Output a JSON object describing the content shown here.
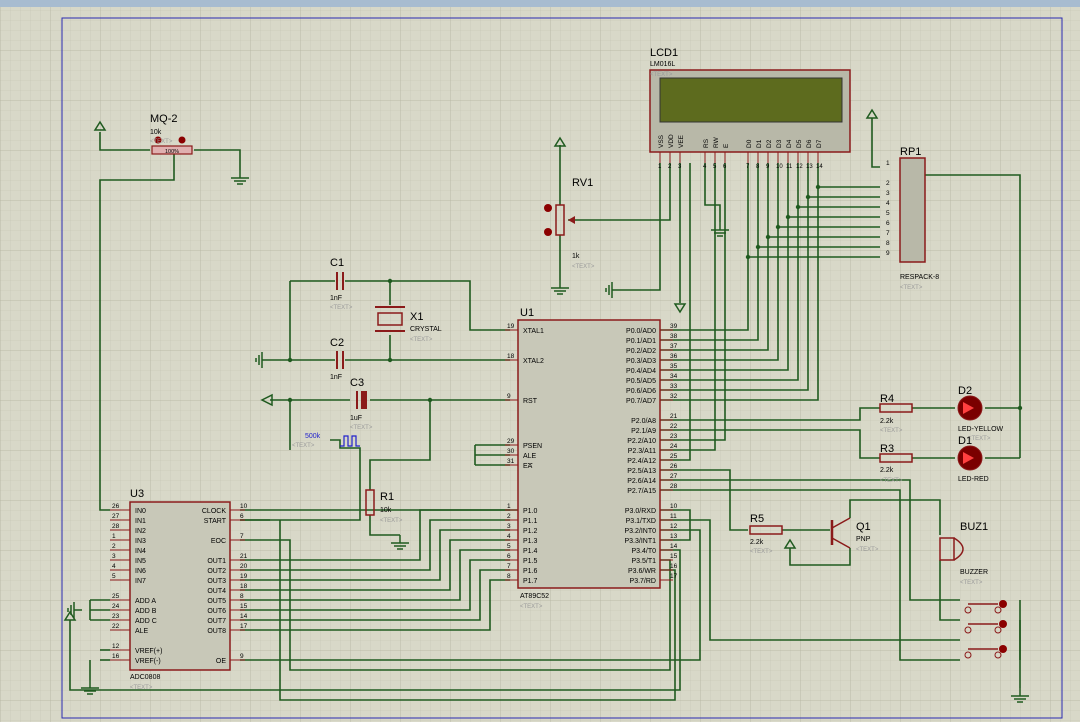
{
  "colors": {
    "wire": "#1f5a1f",
    "part": "#8b1a1a",
    "text": "#000000",
    "ref": "#000000",
    "placeholder": "#9a9a9a",
    "lcd_screen": "#5d6b1e",
    "border": "#2a2ab0",
    "dot": "#8b0000"
  },
  "components": {
    "lcd": {
      "ref": "LCD1",
      "model": "LM016L",
      "text_tag": "<TEXT>",
      "pins": [
        "VSS",
        "VDD",
        "VEE",
        "RS",
        "RW",
        "E",
        "D0",
        "D1",
        "D2",
        "D3",
        "D4",
        "D5",
        "D6",
        "D7"
      ],
      "pin_nums": [
        "1",
        "2",
        "3",
        "4",
        "5",
        "6",
        "7",
        "8",
        "9",
        "10",
        "11",
        "12",
        "13",
        "14"
      ]
    },
    "mq2": {
      "ref": "MQ-2",
      "value": "10k",
      "text_tag": "<TEXT>",
      "pct": "100%"
    },
    "rv1": {
      "ref": "RV1",
      "value": "1k",
      "text_tag": "<TEXT>"
    },
    "rp1": {
      "ref": "RP1",
      "model": "RESPACK-8",
      "text_tag": "<TEXT>",
      "pins": [
        "1",
        "2",
        "3",
        "4",
        "5",
        "6",
        "7",
        "8",
        "9"
      ]
    },
    "c1": {
      "ref": "C1",
      "value": "1nF",
      "text_tag": "<TEXT>"
    },
    "c2": {
      "ref": "C2",
      "value": "1nF",
      "text_tag": "<TEXT>"
    },
    "c3": {
      "ref": "C3",
      "value": "1uF",
      "text_tag": "<TEXT>"
    },
    "x1": {
      "ref": "X1",
      "model": "CRYSTAL",
      "text_tag": "<TEXT>"
    },
    "r1": {
      "ref": "R1",
      "value": "10k",
      "text_tag": "<TEXT>"
    },
    "r3": {
      "ref": "R3",
      "value": "2.2k",
      "text_tag": "<TEXT>"
    },
    "r4": {
      "ref": "R4",
      "value": "2.2k",
      "text_tag": "<TEXT>"
    },
    "r5": {
      "ref": "R5",
      "value": "2.2k",
      "text_tag": "<TEXT>"
    },
    "d1": {
      "ref": "D1",
      "model": "LED-RED",
      "text_tag": "<TEXT>"
    },
    "d2": {
      "ref": "D2",
      "model": "LED-YELLOW",
      "text_tag": "<TEXT>"
    },
    "q1": {
      "ref": "Q1",
      "model": "PNP",
      "text_tag": "<TEXT>"
    },
    "buz1": {
      "ref": "BUZ1",
      "model": "BUZZER",
      "text_tag": "<TEXT>"
    },
    "clock": {
      "value": "500k",
      "text_tag": "<TEXT>"
    },
    "u1": {
      "ref": "U1",
      "model": "AT89C52",
      "text_tag": "<TEXT>",
      "left_pins": [
        {
          "num": "19",
          "name": "XTAL1"
        },
        {
          "num": "18",
          "name": "XTAL2"
        },
        {
          "num": "9",
          "name": "RST"
        },
        {
          "num": "29",
          "name": "PSEN"
        },
        {
          "num": "30",
          "name": "ALE"
        },
        {
          "num": "31",
          "name": "EA"
        },
        {
          "num": "1",
          "name": "P1.0"
        },
        {
          "num": "2",
          "name": "P1.1"
        },
        {
          "num": "3",
          "name": "P1.2"
        },
        {
          "num": "4",
          "name": "P1.3"
        },
        {
          "num": "5",
          "name": "P1.4"
        },
        {
          "num": "6",
          "name": "P1.5"
        },
        {
          "num": "7",
          "name": "P1.6"
        },
        {
          "num": "8",
          "name": "P1.7"
        }
      ],
      "right_pins": [
        {
          "num": "39",
          "name": "P0.0/AD0"
        },
        {
          "num": "38",
          "name": "P0.1/AD1"
        },
        {
          "num": "37",
          "name": "P0.2/AD2"
        },
        {
          "num": "36",
          "name": "P0.3/AD3"
        },
        {
          "num": "35",
          "name": "P0.4/AD4"
        },
        {
          "num": "34",
          "name": "P0.5/AD5"
        },
        {
          "num": "33",
          "name": "P0.6/AD6"
        },
        {
          "num": "32",
          "name": "P0.7/AD7"
        },
        {
          "num": "21",
          "name": "P2.0/A8"
        },
        {
          "num": "22",
          "name": "P2.1/A9"
        },
        {
          "num": "23",
          "name": "P2.2/A10"
        },
        {
          "num": "24",
          "name": "P2.3/A11"
        },
        {
          "num": "25",
          "name": "P2.4/A12"
        },
        {
          "num": "26",
          "name": "P2.5/A13"
        },
        {
          "num": "27",
          "name": "P2.6/A14"
        },
        {
          "num": "28",
          "name": "P2.7/A15"
        },
        {
          "num": "10",
          "name": "P3.0/RXD"
        },
        {
          "num": "11",
          "name": "P3.1/TXD"
        },
        {
          "num": "12",
          "name": "P3.2/INT0"
        },
        {
          "num": "13",
          "name": "P3.3/INT1"
        },
        {
          "num": "14",
          "name": "P3.4/T0"
        },
        {
          "num": "15",
          "name": "P3.5/T1"
        },
        {
          "num": "16",
          "name": "P3.6/WR"
        },
        {
          "num": "17",
          "name": "P3.7/RD"
        }
      ]
    },
    "u3": {
      "ref": "U3",
      "model": "ADC0808",
      "text_tag": "<TEXT>",
      "left_pins": [
        {
          "num": "26",
          "name": "IN0"
        },
        {
          "num": "27",
          "name": "IN1"
        },
        {
          "num": "28",
          "name": "IN2"
        },
        {
          "num": "1",
          "name": "IN3"
        },
        {
          "num": "2",
          "name": "IN4"
        },
        {
          "num": "3",
          "name": "IN5"
        },
        {
          "num": "4",
          "name": "IN6"
        },
        {
          "num": "5",
          "name": "IN7"
        },
        {
          "num": "25",
          "name": "ADD A"
        },
        {
          "num": "24",
          "name": "ADD B"
        },
        {
          "num": "23",
          "name": "ADD C"
        },
        {
          "num": "22",
          "name": "ALE"
        },
        {
          "num": "12",
          "name": "VREF(+)"
        },
        {
          "num": "16",
          "name": "VREF(-)"
        }
      ],
      "right_pins": [
        {
          "num": "10",
          "name": "CLOCK"
        },
        {
          "num": "6",
          "name": "START"
        },
        {
          "num": "7",
          "name": "EOC"
        },
        {
          "num": "21",
          "name": "OUT1"
        },
        {
          "num": "20",
          "name": "OUT2"
        },
        {
          "num": "19",
          "name": "OUT3"
        },
        {
          "num": "18",
          "name": "OUT4"
        },
        {
          "num": "8",
          "name": "OUT5"
        },
        {
          "num": "15",
          "name": "OUT6"
        },
        {
          "num": "14",
          "name": "OUT7"
        },
        {
          "num": "17",
          "name": "OUT8"
        },
        {
          "num": "9",
          "name": "OE"
        }
      ]
    }
  }
}
